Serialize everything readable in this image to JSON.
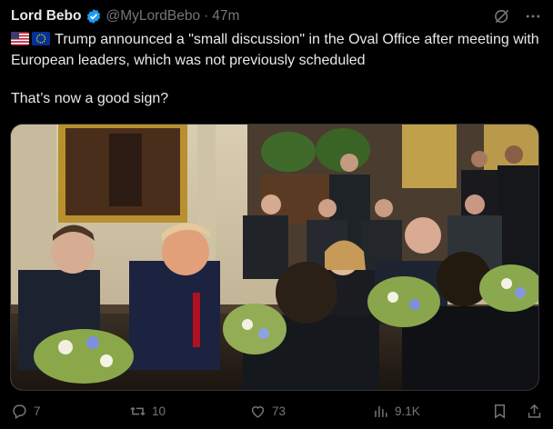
{
  "post": {
    "author_name": "Lord Bebo",
    "handle": "@MyLordBebo",
    "separator": "·",
    "time": "47m",
    "flags": "🇺🇸🇪🇺",
    "line1": "Trump announced a \"small discussion\" in the Oval Office after meeting with European leaders, which was not previously scheduled",
    "line2": "That’s now a good sign?"
  },
  "actions": {
    "replies": "7",
    "reposts": "10",
    "likes": "73",
    "views": "9.1K"
  },
  "colors": {
    "background": "#000000",
    "text": "#e7e9ea",
    "muted": "#71767b",
    "verified": "#1d9bf0"
  },
  "icons": [
    "verified-badge-icon",
    "grok-icon",
    "more-icon",
    "reply-icon",
    "repost-icon",
    "like-icon",
    "views-icon",
    "bookmark-icon",
    "share-icon"
  ]
}
